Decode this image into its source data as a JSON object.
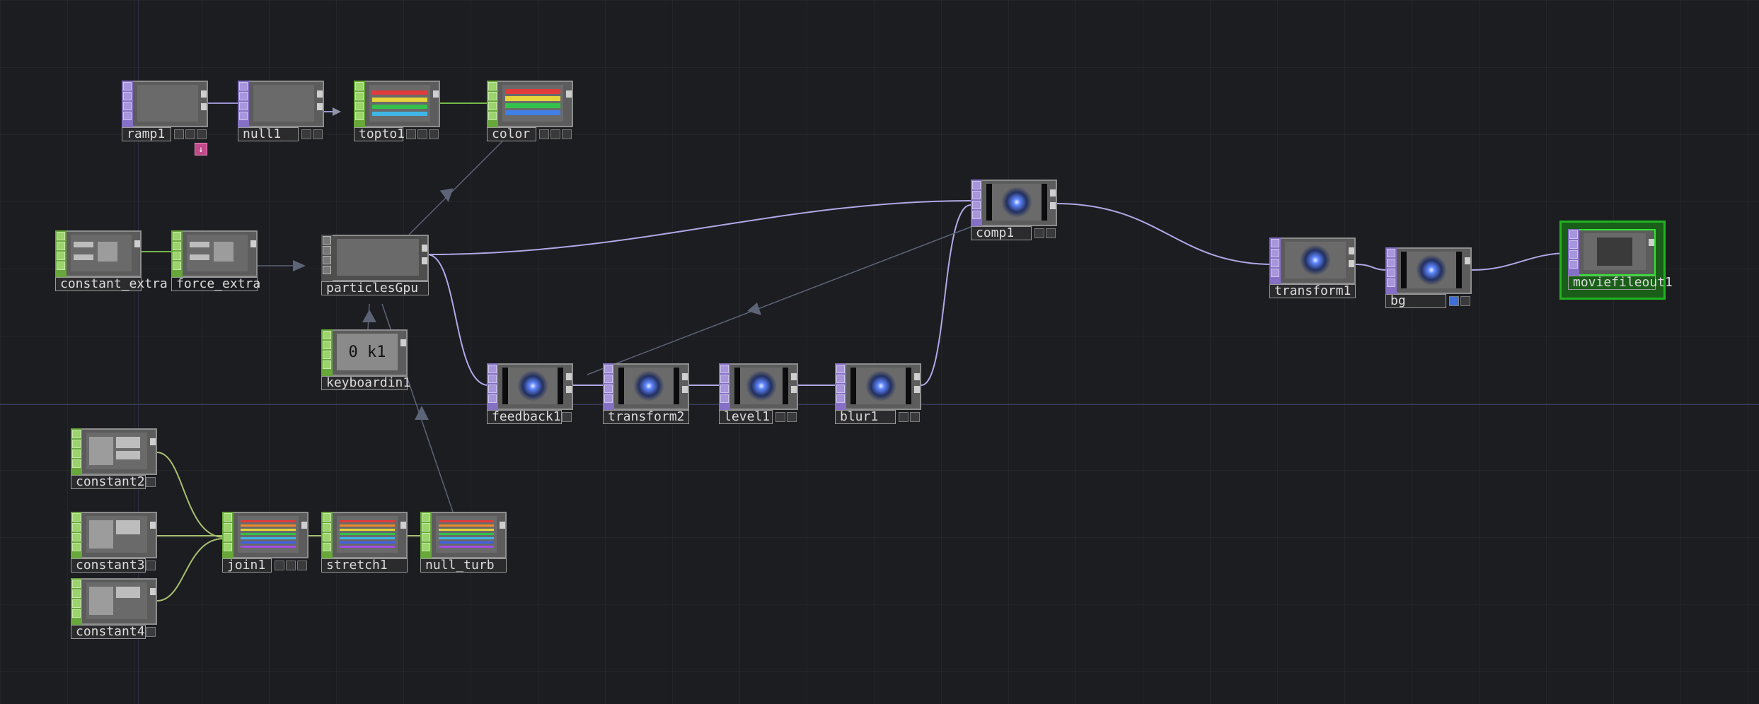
{
  "app": {
    "accent_selected": "#2ee62e",
    "top_color": "#8570c5",
    "chop_color": "#68a83a"
  },
  "nodes": {
    "ramp1": {
      "label": "ramp1",
      "family": "TOP"
    },
    "null1": {
      "label": "null1",
      "family": "TOP"
    },
    "topto1": {
      "label": "topto1",
      "family": "CHOP"
    },
    "color": {
      "label": "color",
      "family": "CHOP"
    },
    "constant_extra": {
      "label": "constant_extra",
      "family": "CHOP"
    },
    "force_extra": {
      "label": "force_extra",
      "family": "CHOP"
    },
    "particlesGpu": {
      "label": "particlesGpu",
      "family": "COMP"
    },
    "keyboardin1": {
      "label": "keyboardin1",
      "family": "CHOP",
      "display": "0 k1"
    },
    "comp1": {
      "label": "comp1",
      "family": "TOP"
    },
    "feedback1": {
      "label": "feedback1",
      "family": "TOP"
    },
    "transform2": {
      "label": "transform2",
      "family": "TOP"
    },
    "level1": {
      "label": "level1",
      "family": "TOP"
    },
    "blur1": {
      "label": "blur1",
      "family": "TOP"
    },
    "transform1": {
      "label": "transform1",
      "family": "TOP"
    },
    "bg": {
      "label": "bg",
      "family": "TOP"
    },
    "moviefileout1": {
      "label": "moviefileout1",
      "family": "TOP",
      "selected": true
    },
    "constant2": {
      "label": "constant2",
      "family": "CHOP"
    },
    "constant3": {
      "label": "constant3",
      "family": "CHOP"
    },
    "constant4": {
      "label": "constant4",
      "family": "CHOP"
    },
    "join1": {
      "label": "join1",
      "family": "CHOP"
    },
    "stretch1": {
      "label": "stretch1",
      "family": "CHOP"
    },
    "null_turb": {
      "label": "null_turb",
      "family": "CHOP"
    }
  },
  "icons": {
    "ramp_badge": "down-arrow-icon",
    "input_flag": "input-flag-icon"
  }
}
